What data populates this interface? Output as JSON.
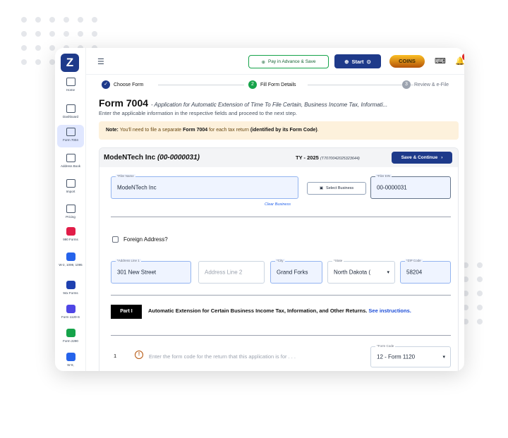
{
  "app": {
    "logo": "Z",
    "menu_icon": "hamburger-icon"
  },
  "sidebar": {
    "items": [
      {
        "label": "Home",
        "icon": "grid-icon"
      },
      {
        "label": "Dashboard",
        "icon": "dashboard-icon"
      },
      {
        "label": "Form 7004",
        "icon": "document-icon"
      },
      {
        "label": "Address Book",
        "icon": "address-book-icon"
      },
      {
        "label": "Import",
        "icon": "import-icon"
      },
      {
        "label": "Pricing",
        "icon": "pricing-icon"
      },
      {
        "label": "990 Forms",
        "icon": "heart-icon"
      },
      {
        "label": "W-2, 1099, 1095",
        "icon": "forms-icon"
      },
      {
        "label": "94x Forms",
        "icon": "people-icon"
      },
      {
        "label": "Form 1120-S",
        "icon": "building-icon"
      },
      {
        "label": "Form 2290",
        "icon": "truck-icon"
      },
      {
        "label": "W-9,",
        "icon": "w9-icon"
      }
    ]
  },
  "topbar": {
    "pay_label": "Pay in Advance & Save",
    "start_label": "Start",
    "coins_label": "COINS",
    "badge_count": "0"
  },
  "steps": [
    {
      "num": "✓",
      "label": "Choose Form",
      "color": "#1e3a8a"
    },
    {
      "num": "2",
      "label": "Fill Form Details",
      "color": "#16a34a"
    },
    {
      "num": "3",
      "label": "Review & e-File",
      "color": "#9ca3af"
    }
  ],
  "form": {
    "title": "Form 7004",
    "title_desc": "- Application for Automatic Extension of Time To File Certain, Business Income Tax, Informati...",
    "subtitle": "Enter the applicable information in the respective fields and proceed to the next step."
  },
  "note": {
    "prefix": "Note:",
    "text1": " You'll need to file a separate ",
    "bold1": "Form 7004",
    "text2": " for each tax return ",
    "bold2": "(identified by its Form Code)",
    "text3": "."
  },
  "business": {
    "name": "ModeNTech Inc",
    "ein_paren": "(00-0000031)",
    "ty": "TY - 2025",
    "ty_id": "(T7070042025323644)",
    "save_label": "Save & Continue"
  },
  "fields": {
    "filer_name_label": "*Filer Name",
    "filer_name": "ModeNTech Inc",
    "select_business": "Select Business",
    "clear_business": "Clear Business",
    "filer_ein_label": "*Filer EIN",
    "filer_ein": "00-0000031",
    "foreign_address": "Foreign Address?",
    "address1_label": "*Address Line 1",
    "address1": "301 New Street",
    "address2_placeholder": "Address Line 2",
    "city_label": "*City",
    "city": "Grand Forks",
    "state_label": "*State",
    "state": "North Dakota (",
    "zip_label": "*ZIP Code",
    "zip": "58204"
  },
  "part1": {
    "tag": "Part I",
    "text": "Automatic Extension for Certain Business Income Tax, Information, and Other Returns.",
    "link": "See instructions."
  },
  "line1": {
    "num": "1",
    "question": "Enter the form code for the return that this application is for . . .",
    "code_label": "*Form Code",
    "code_value": "12 - Form 1120"
  }
}
